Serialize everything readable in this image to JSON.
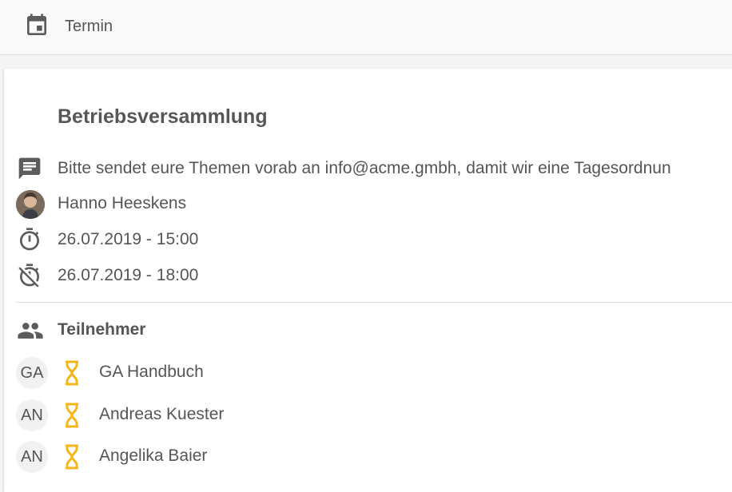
{
  "header": {
    "title": "Termin",
    "icon": "calendar-icon"
  },
  "event": {
    "title": "Betriebsversammlung",
    "description": "Bitte sendet eure Themen vorab an info@acme.gmbh, damit wir eine Tagesordnun",
    "organizer": "Hanno Heeskens",
    "start": "26.07.2019 - 15:00",
    "end": "26.07.2019 - 18:00"
  },
  "participants": {
    "title": "Teilnehmer",
    "items": [
      {
        "initials": "GA",
        "name": "GA Handbuch",
        "status_icon": "hourglass-icon"
      },
      {
        "initials": "AN",
        "name": "Andreas Kuester",
        "status_icon": "hourglass-icon"
      },
      {
        "initials": "AN",
        "name": "Angelika Baier",
        "status_icon": "hourglass-icon"
      }
    ]
  },
  "colors": {
    "pending": "#f6b61a",
    "icon": "#5c5c5c"
  }
}
